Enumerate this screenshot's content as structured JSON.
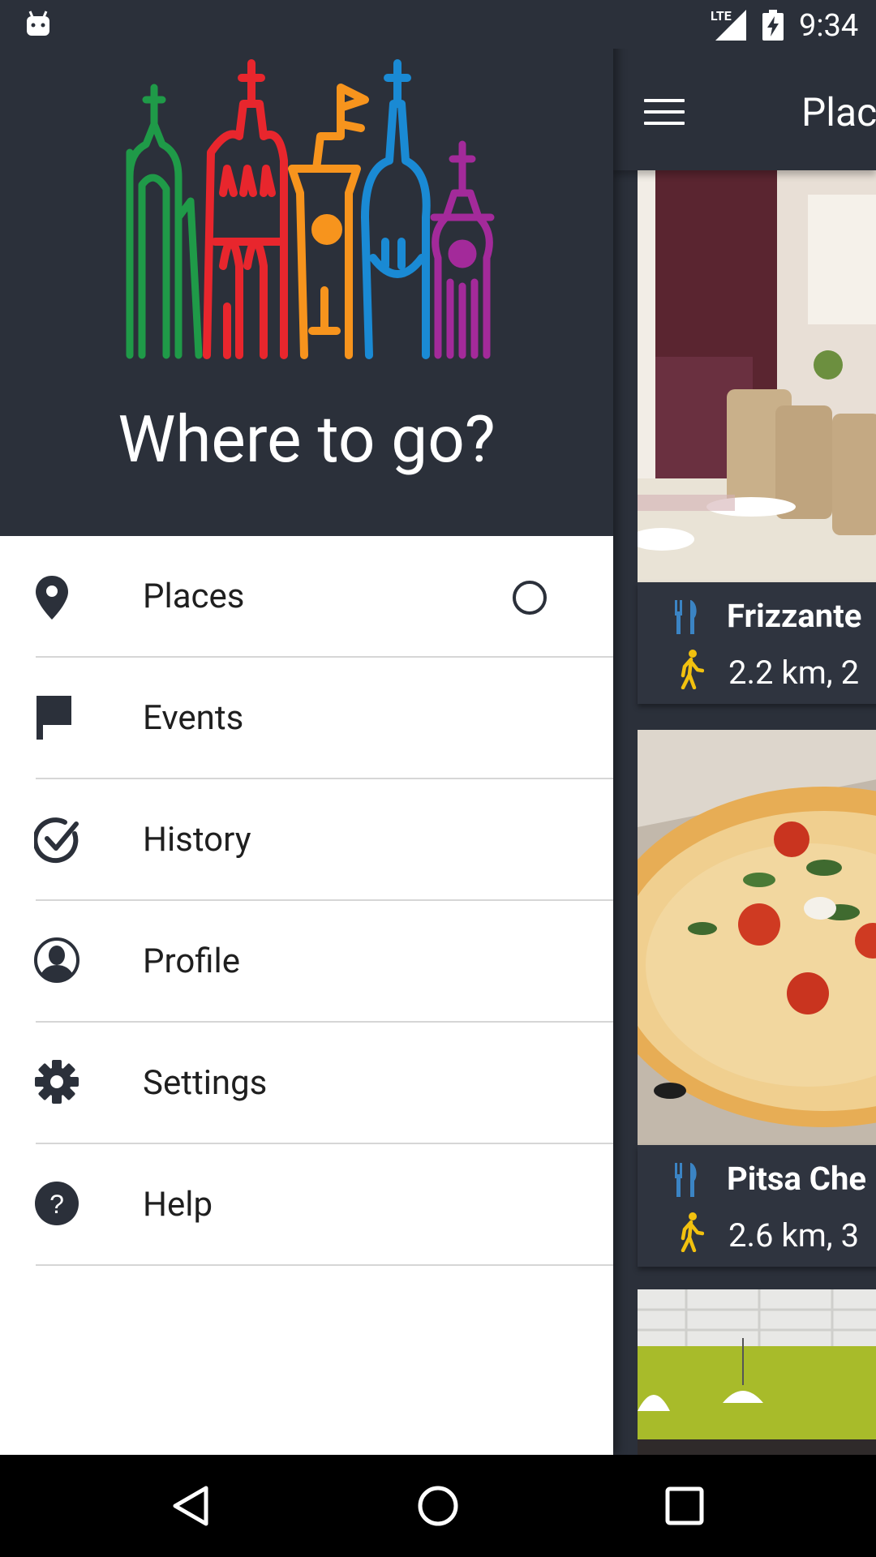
{
  "status_bar": {
    "network": "LTE",
    "time": "9:34"
  },
  "drawer": {
    "header_title": "Where to go?",
    "items": [
      {
        "label": "Places",
        "icon": "location-pin-icon",
        "selected": true
      },
      {
        "label": "Events",
        "icon": "flag-icon"
      },
      {
        "label": "History",
        "icon": "check-circle-icon"
      },
      {
        "label": "Profile",
        "icon": "person-circle-icon"
      },
      {
        "label": "Settings",
        "icon": "gear-icon"
      },
      {
        "label": "Help",
        "icon": "help-circle-icon"
      }
    ]
  },
  "app": {
    "toolbar_title": "Plac",
    "cards": [
      {
        "name": "Frizzante",
        "distance": "2.2 km,  2"
      },
      {
        "name": "Pitsa Che",
        "distance": "2.6 km,  3"
      }
    ]
  },
  "colors": {
    "dark_bg": "#2b303a",
    "walk_icon": "#f2c10f",
    "food_icon": "#3b84c4"
  }
}
